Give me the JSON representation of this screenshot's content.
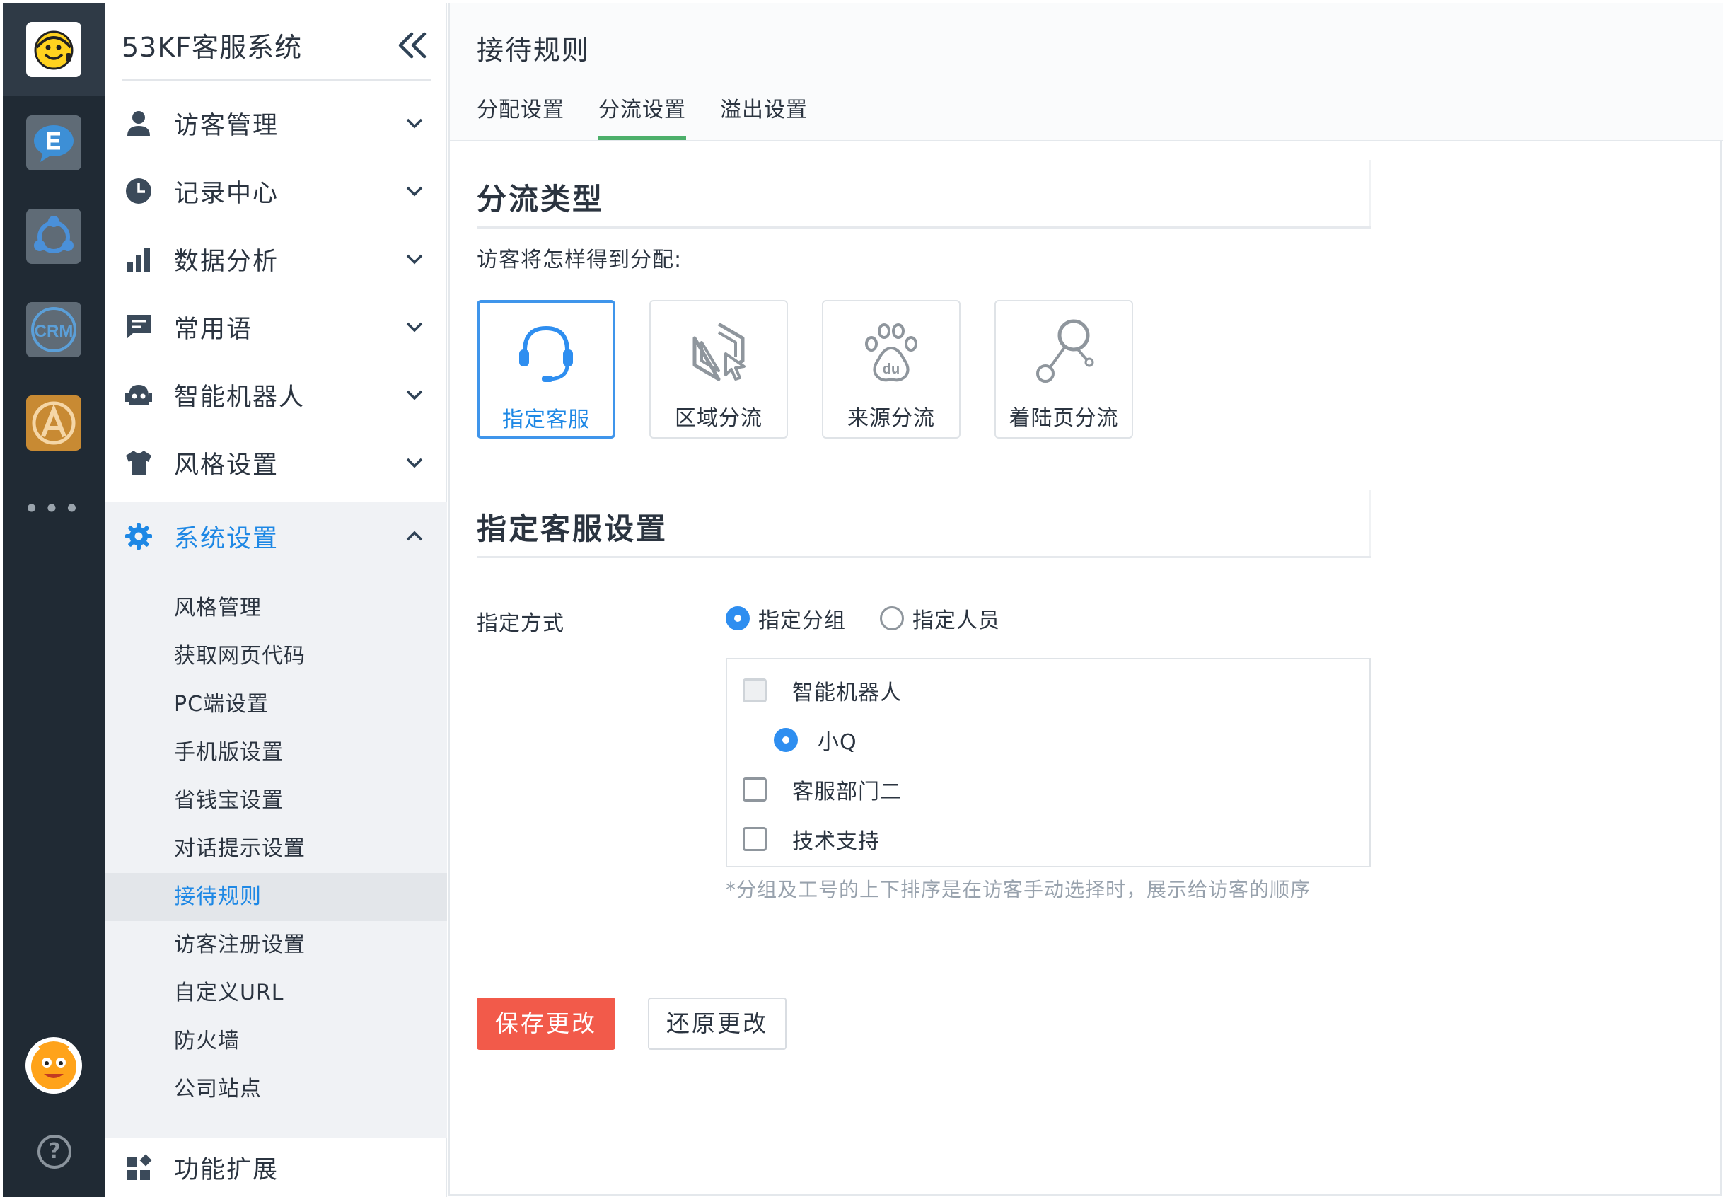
{
  "rail": {
    "apps": [
      {
        "name": "smiley-logo-icon"
      },
      {
        "name": "chat-e-icon",
        "color": "#3d8fd6"
      },
      {
        "name": "network-icon",
        "color": "#4a90d9"
      },
      {
        "name": "crm-icon",
        "text": "CRM",
        "color": "#5b9fd8"
      },
      {
        "name": "a-app-icon",
        "color": "#e8a13a"
      }
    ],
    "more": "•••",
    "help": "?"
  },
  "sidebar": {
    "brand": "53KF客服系统",
    "menu": [
      {
        "label": "访客管理",
        "icon": "person-icon"
      },
      {
        "label": "记录中心",
        "icon": "clock-icon"
      },
      {
        "label": "数据分析",
        "icon": "bar-chart-icon"
      },
      {
        "label": "常用语",
        "icon": "message-icon"
      },
      {
        "label": "智能机器人",
        "icon": "robot-icon"
      },
      {
        "label": "风格设置",
        "icon": "shirt-icon"
      },
      {
        "label": "系统设置",
        "icon": "gear-icon",
        "active": true
      }
    ],
    "submenu": [
      {
        "label": "风格管理"
      },
      {
        "label": "获取网页代码"
      },
      {
        "label": "PC端设置"
      },
      {
        "label": "手机版设置"
      },
      {
        "label": "省钱宝设置"
      },
      {
        "label": "对话提示设置"
      },
      {
        "label": "接待规则",
        "active": true
      },
      {
        "label": "访客注册设置"
      },
      {
        "label": "自定义URL"
      },
      {
        "label": "防火墙"
      },
      {
        "label": "公司站点"
      }
    ],
    "extension": {
      "label": "功能扩展",
      "icon": "apps-icon"
    }
  },
  "main": {
    "title": "接待规则",
    "tabs": [
      {
        "label": "分配设置"
      },
      {
        "label": "分流设置",
        "active": true
      },
      {
        "label": "溢出设置"
      }
    ],
    "split_section": {
      "title": "分流类型",
      "hint": "访客将怎样得到分配:",
      "types": [
        {
          "label": "指定客服",
          "icon": "headset-icon",
          "active": true
        },
        {
          "label": "区域分流",
          "icon": "region-cursor-icon"
        },
        {
          "label": "来源分流",
          "icon": "baidu-paw-icon"
        },
        {
          "label": "着陆页分流",
          "icon": "landing-nodes-icon"
        }
      ]
    },
    "assign_section": {
      "title": "指定客服设置",
      "method_label": "指定方式",
      "methods": [
        {
          "label": "指定分组",
          "checked": true
        },
        {
          "label": "指定人员",
          "checked": false
        }
      ],
      "groups": [
        {
          "label": "智能机器人",
          "disabled": true
        },
        {
          "label": "小Q",
          "child": true,
          "selected": true
        },
        {
          "label": "客服部门二"
        },
        {
          "label": "技术支持"
        }
      ],
      "note": "*分组及工号的上下排序是在访客手动选择时，展示给访客的顺序"
    },
    "actions": {
      "save": "保存更改",
      "reset": "还原更改"
    },
    "colors": {
      "accent": "#1e88e5",
      "tab_underline": "#4caf6a",
      "save_button": "#f25a4a"
    }
  }
}
